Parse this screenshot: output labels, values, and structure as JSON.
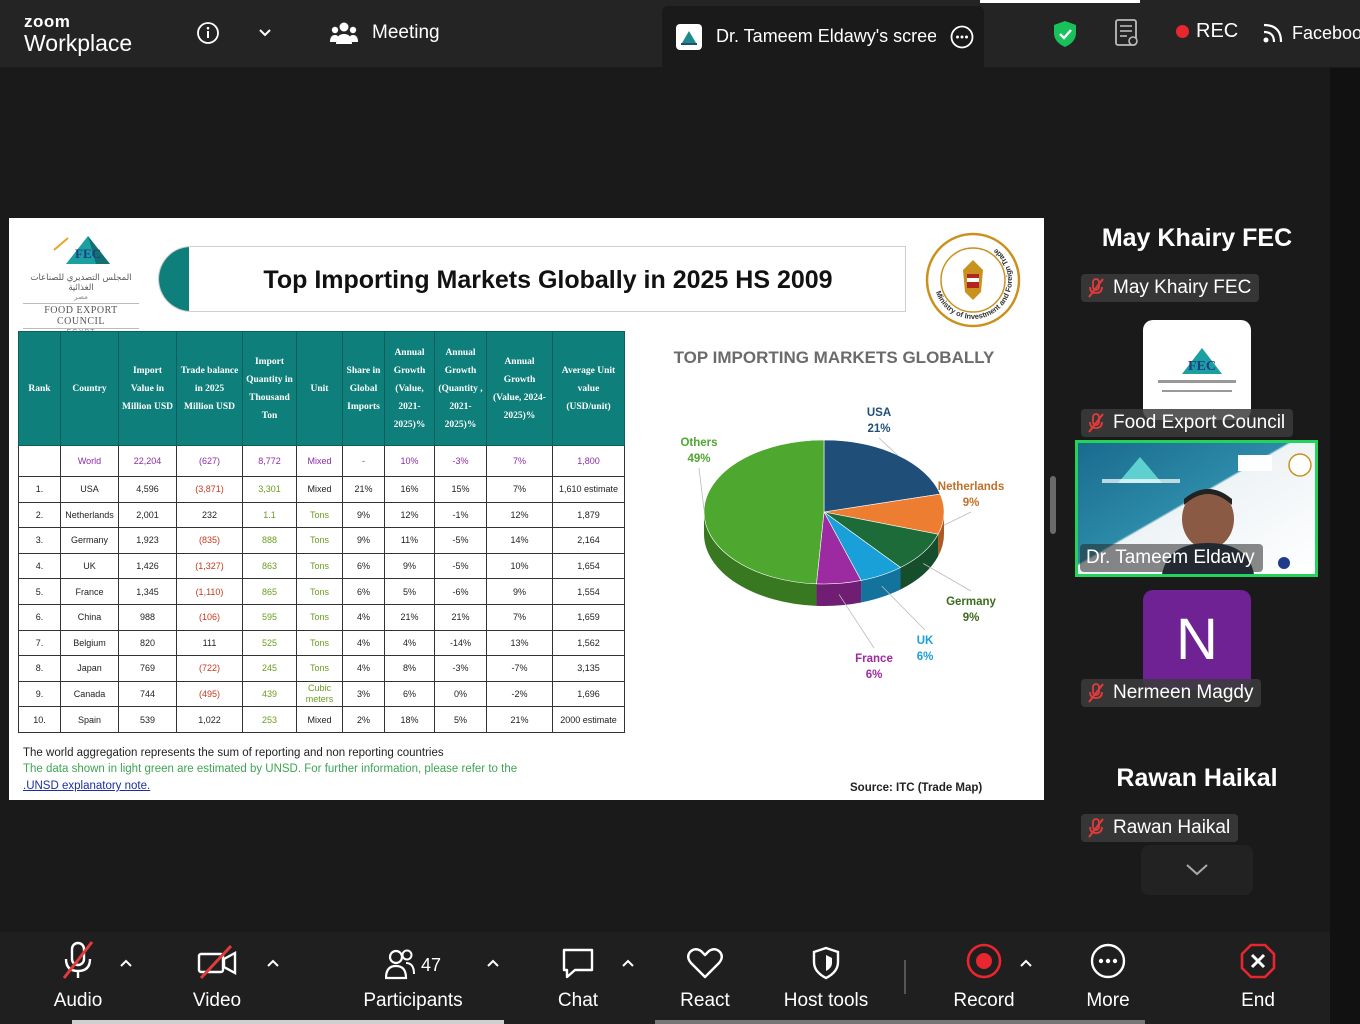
{
  "app": {
    "logo_top": "zoom",
    "logo_bottom": "Workplace",
    "meeting_label": "Meeting",
    "share_tab_title": "Dr. Tameem Eldawy's screen",
    "rec_label": "REC",
    "live_label": "Faceboo"
  },
  "slide": {
    "title": "Top Importing Markets Globally in 2025 HS 2009",
    "logo_text": "FEC",
    "logo_arabic": "المجلس التصديري للصناعات الغذائية",
    "logo_arabic_country": "مصر",
    "logo_english": "FOOD EXPORT COUNCIL",
    "logo_country": "EGYPT",
    "seal_text": "Ministry of Investment and Foreign Trade",
    "note1": "The world aggregation represents the sum of reporting and non reporting countries",
    "note2": "The data shown in light green are estimated by UNSD. For further information, please refer to the",
    "note3": ".UNSD explanatory note.",
    "source": "Source: ITC (Trade Map)",
    "table": {
      "headers": [
        "Rank",
        "Country",
        "Import Value in Million USD",
        "Trade balance in 2025 Million USD",
        "Import Quantity in Thousand Ton",
        "Unit",
        "Share in Global Imports",
        "Annual Growth (Value, 2021-2025)%",
        "Annual Growth (Quantity , 2021-2025)%",
        "Annual Growth (Value, 2024-2025)%",
        "Average Unit value (USD/unit)"
      ],
      "rows": [
        [
          "",
          "World",
          "22,204",
          "(627)",
          "8,772",
          "Mixed",
          "-",
          "10%",
          "-3%",
          "7%",
          "1,800"
        ],
        [
          "1.",
          "USA",
          "4,596",
          "(3,871)",
          "3,301",
          "Mixed",
          "21%",
          "16%",
          "15%",
          "7%",
          "1,610 estimate"
        ],
        [
          "2.",
          "Netherlands",
          "2,001",
          "232",
          "1.1",
          "Tons",
          "9%",
          "12%",
          "-1%",
          "12%",
          "1,879"
        ],
        [
          "3.",
          "Germany",
          "1,923",
          "(835)",
          "888",
          "Tons",
          "9%",
          "11%",
          "-5%",
          "14%",
          "2,164"
        ],
        [
          "4.",
          "UK",
          "1,426",
          "(1,327)",
          "863",
          "Tons",
          "6%",
          "9%",
          "-5%",
          "10%",
          "1,654"
        ],
        [
          "5.",
          "France",
          "1,345",
          "(1,110)",
          "865",
          "Tons",
          "6%",
          "5%",
          "-6%",
          "9%",
          "1,554"
        ],
        [
          "6.",
          "China",
          "988",
          "(106)",
          "595",
          "Tons",
          "4%",
          "21%",
          "21%",
          "7%",
          "1,659"
        ],
        [
          "7.",
          "Belgium",
          "820",
          "111",
          "525",
          "Tons",
          "4%",
          "4%",
          "-14%",
          "13%",
          "1,562"
        ],
        [
          "8.",
          "Japan",
          "769",
          "(722)",
          "245",
          "Tons",
          "4%",
          "8%",
          "-3%",
          "-7%",
          "3,135"
        ],
        [
          "9.",
          "Canada",
          "744",
          "(495)",
          "439",
          "Cubic meters",
          "3%",
          "6%",
          "0%",
          "-2%",
          "1,696"
        ],
        [
          "10.",
          "Spain",
          "539",
          "1,022",
          "253",
          "Mixed",
          "2%",
          "18%",
          "5%",
          "21%",
          "2000 estimate"
        ]
      ]
    }
  },
  "chart_data": {
    "type": "pie",
    "title": "TOP IMPORTING MARKETS GLOBALLY",
    "categories": [
      "USA",
      "Netherlands",
      "Germany",
      "UK",
      "France",
      "Others"
    ],
    "values": [
      21,
      9,
      9,
      6,
      6,
      49
    ],
    "labels": [
      "21%",
      "9%",
      "9%",
      "6%",
      "6%",
      "49%"
    ],
    "colors": [
      "#1f4e79",
      "#ed7d31",
      "#1e6b3a",
      "#1aa0d8",
      "#9c2aa0",
      "#4ea72e"
    ],
    "label_colors": [
      "#1f4e79",
      "#c0702a",
      "#3d6b1e",
      "#1aa0d8",
      "#9c2aa0",
      "#4ea72e"
    ]
  },
  "participants": [
    {
      "name": "May Khairy FEC",
      "label": "May Khairy FEC"
    },
    {
      "label": "Food Export Council",
      "tile_text": "FEC"
    },
    {
      "label": "Dr. Tameem Eldawy"
    },
    {
      "label": "Nermeen Magdy",
      "initial": "N"
    },
    {
      "name": "Rawan Haikal",
      "label": "Rawan Haikal"
    }
  ],
  "toolbar": {
    "audio": "Audio",
    "video": "Video",
    "participants": "Participants",
    "participants_count": "47",
    "chat": "Chat",
    "react": "React",
    "host_tools": "Host tools",
    "record": "Record",
    "more": "More",
    "end": "End"
  }
}
